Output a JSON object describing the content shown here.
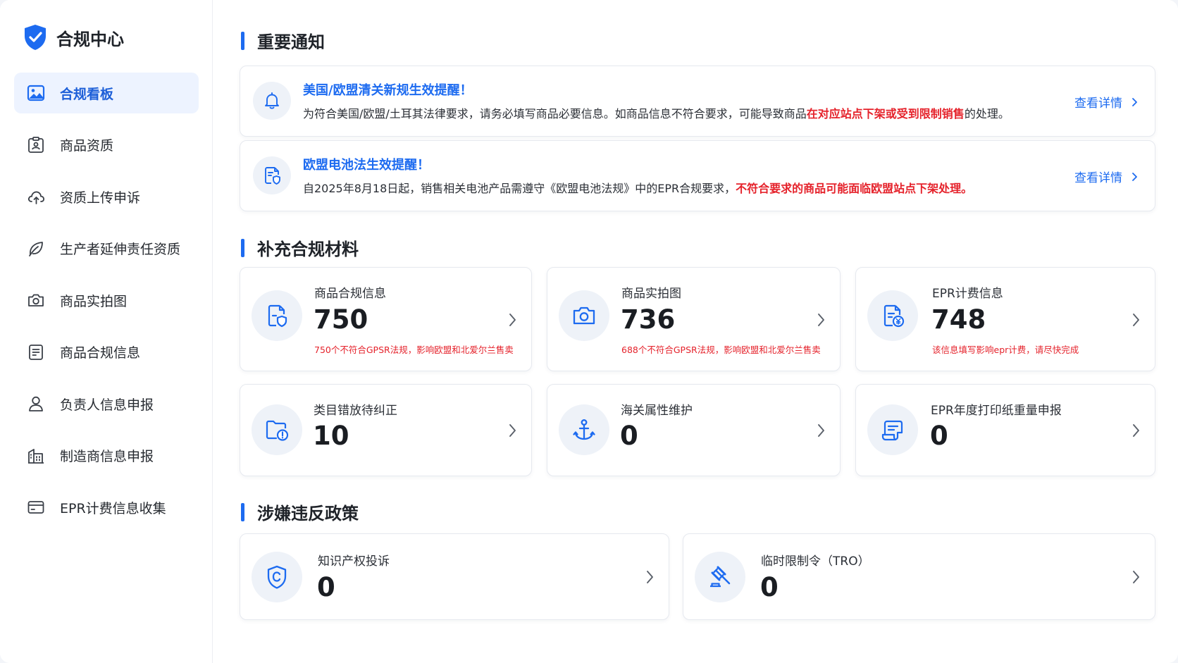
{
  "app": {
    "title": "合规中心"
  },
  "sidebar": {
    "items": [
      {
        "label": "合规看板",
        "icon": "dashboard-image-icon",
        "active": true
      },
      {
        "label": "商品资质",
        "icon": "id-card-icon"
      },
      {
        "label": "资质上传申诉",
        "icon": "cloud-upload-icon"
      },
      {
        "label": "生产者延伸责任资质",
        "icon": "leaf-icon"
      },
      {
        "label": "商品实拍图",
        "icon": "camera-icon"
      },
      {
        "label": "商品合规信息",
        "icon": "document-list-icon"
      },
      {
        "label": "负责人信息申报",
        "icon": "user-icon"
      },
      {
        "label": "制造商信息申报",
        "icon": "building-icon"
      },
      {
        "label": "EPR计费信息收集",
        "icon": "credit-card-icon"
      }
    ]
  },
  "sections": {
    "notices_title": "重要通知",
    "materials_title": "补充合规材料",
    "violations_title": "涉嫌违反政策"
  },
  "notices": [
    {
      "icon": "bell-icon",
      "title": "美国/欧盟清关新规生效提醒！",
      "body_prefix": "为符合美国/欧盟/土耳其法律要求，请务必填写商品必要信息。如商品信息不符合要求，可能导致商品",
      "body_highlight": "在对应站点下架或受到限制销售",
      "body_suffix": "的处理。",
      "link": "查看详情"
    },
    {
      "icon": "document-shield-icon",
      "title": "欧盟电池法生效提醒！",
      "body_prefix": "自2025年8月18日起，销售相关电池产品需遵守《欧盟电池法规》中的EPR合规要求，",
      "body_highlight": "不符合要求的商品可能面临欧盟站点下架处理。",
      "body_suffix": "",
      "link": "查看详情"
    }
  ],
  "materials": [
    {
      "label": "商品合规信息",
      "value": "750",
      "warning": "750个不符合GPSR法规，影响欧盟和北爱尔兰售卖",
      "icon": "document-shield-icon"
    },
    {
      "label": "商品实拍图",
      "value": "736",
      "warning": "688个不符合GPSR法规，影响欧盟和北爱尔兰售卖",
      "icon": "camera-icon"
    },
    {
      "label": "EPR计费信息",
      "value": "748",
      "warning": "该信息填写影响epr计费，请尽快完成",
      "icon": "yen-document-icon"
    },
    {
      "label": "类目错放待纠正",
      "value": "10",
      "warning": "",
      "icon": "folder-alert-icon"
    },
    {
      "label": "海关属性维护",
      "value": "0",
      "warning": "",
      "icon": "anchor-icon"
    },
    {
      "label": "EPR年度打印纸重量申报",
      "value": "0",
      "warning": "",
      "icon": "paper-scroll-icon"
    }
  ],
  "violations": [
    {
      "label": "知识产权投诉",
      "value": "0",
      "icon": "copyright-shield-icon"
    },
    {
      "label": "临时限制令（TRO）",
      "value": "0",
      "icon": "gavel-icon"
    }
  ],
  "colors": {
    "accent": "#1d6bf0",
    "warning": "#e5222b",
    "active_bg": "#edf3ff",
    "icon_bg": "#eef2f8"
  }
}
